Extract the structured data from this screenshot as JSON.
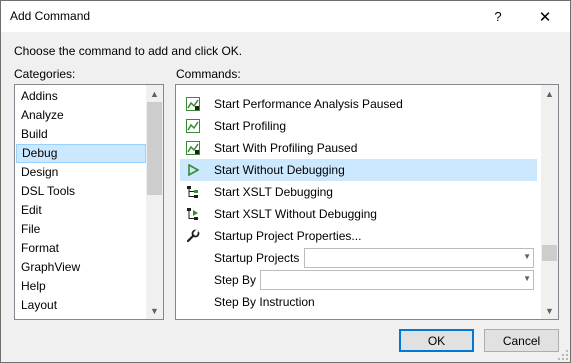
{
  "window": {
    "title": "Add Command",
    "help_glyph": "?",
    "close_glyph": "✕"
  },
  "prompt": "Choose the command to add and click OK.",
  "categories": {
    "label": "Categories:",
    "items": [
      {
        "label": "Addins"
      },
      {
        "label": "Analyze"
      },
      {
        "label": "Build"
      },
      {
        "label": "Debug",
        "selected": true
      },
      {
        "label": "Design"
      },
      {
        "label": "DSL Tools"
      },
      {
        "label": "Edit"
      },
      {
        "label": "File"
      },
      {
        "label": "Format"
      },
      {
        "label": "GraphView"
      },
      {
        "label": "Help"
      },
      {
        "label": "Layout"
      }
    ]
  },
  "commands": {
    "label": "Commands:",
    "items": [
      {
        "label": "Start Performance Analysis Paused",
        "icon": "performance-chart-icon"
      },
      {
        "label": "Start Profiling",
        "icon": "profiling-chart-icon"
      },
      {
        "label": "Start With Profiling Paused",
        "icon": "profiling-paused-icon"
      },
      {
        "label": "Start Without Debugging",
        "icon": "play-triangle-icon",
        "selected": true
      },
      {
        "label": "Start XSLT Debugging",
        "icon": "xslt-tree-icon"
      },
      {
        "label": "Start XSLT Without Debugging",
        "icon": "xslt-run-icon"
      },
      {
        "label": "Startup Project Properties...",
        "icon": "wrench-icon"
      },
      {
        "label": "Startup Projects",
        "combo": true
      },
      {
        "label": "Step By",
        "combo": true
      },
      {
        "label": "Step By Instruction"
      }
    ]
  },
  "buttons": {
    "ok": "OK",
    "cancel": "Cancel"
  },
  "colors": {
    "selection": "#cce8ff",
    "accent": "#0078d7",
    "icon_green": "#388a34"
  }
}
